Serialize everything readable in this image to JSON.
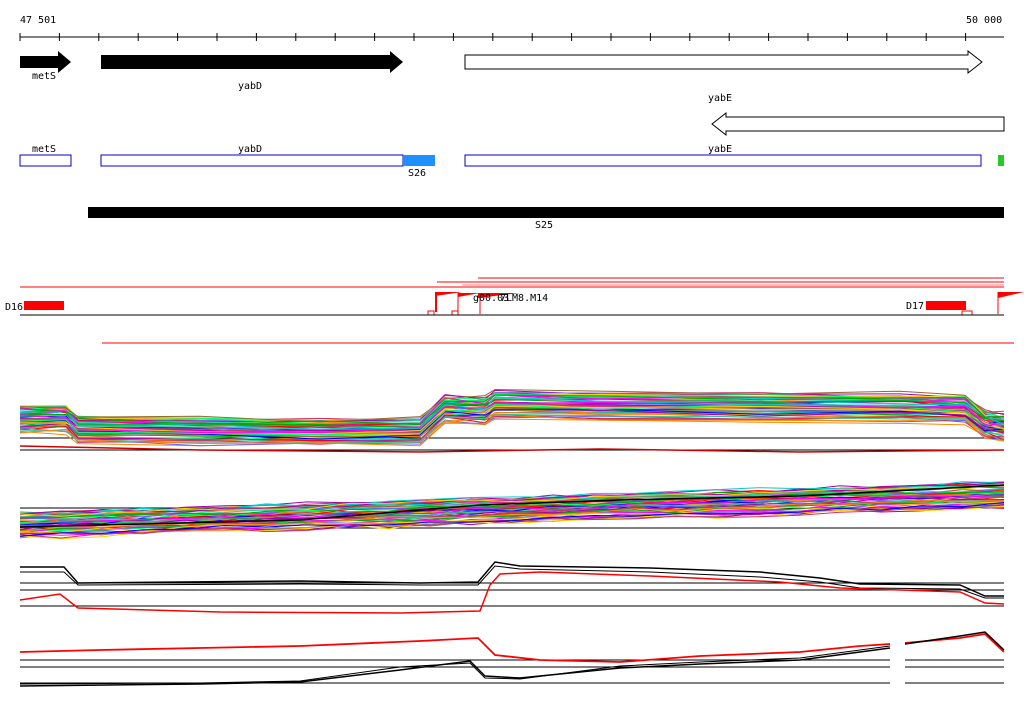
{
  "ruler": {
    "start_label": "47 501",
    "end_label": "50 000"
  },
  "genes": [
    {
      "name": "metS",
      "strand": "+"
    },
    {
      "name": "yabD",
      "strand": "+"
    },
    {
      "name": "yabE",
      "strand": "+"
    },
    {
      "name": "",
      "strand": "-"
    }
  ],
  "cds": [
    {
      "name": "metS"
    },
    {
      "name": "yabD"
    },
    {
      "name": "S26"
    },
    {
      "name": "yabE"
    },
    {
      "name": ""
    }
  ],
  "segments": [
    {
      "name": "S25"
    }
  ],
  "features": [
    {
      "name": "D16"
    },
    {
      "name": "g00.03"
    },
    {
      "name": "7LM8.M14"
    },
    {
      "name": "D17"
    }
  ],
  "colors": {
    "gene_plus": "#000000",
    "gene_minus": "#ffffff",
    "cds_outline": "#0000cc",
    "cds_s26": "#1e90ff",
    "cds_small": "#22cc22",
    "feature": "#ff0000",
    "segment": "#000000"
  }
}
